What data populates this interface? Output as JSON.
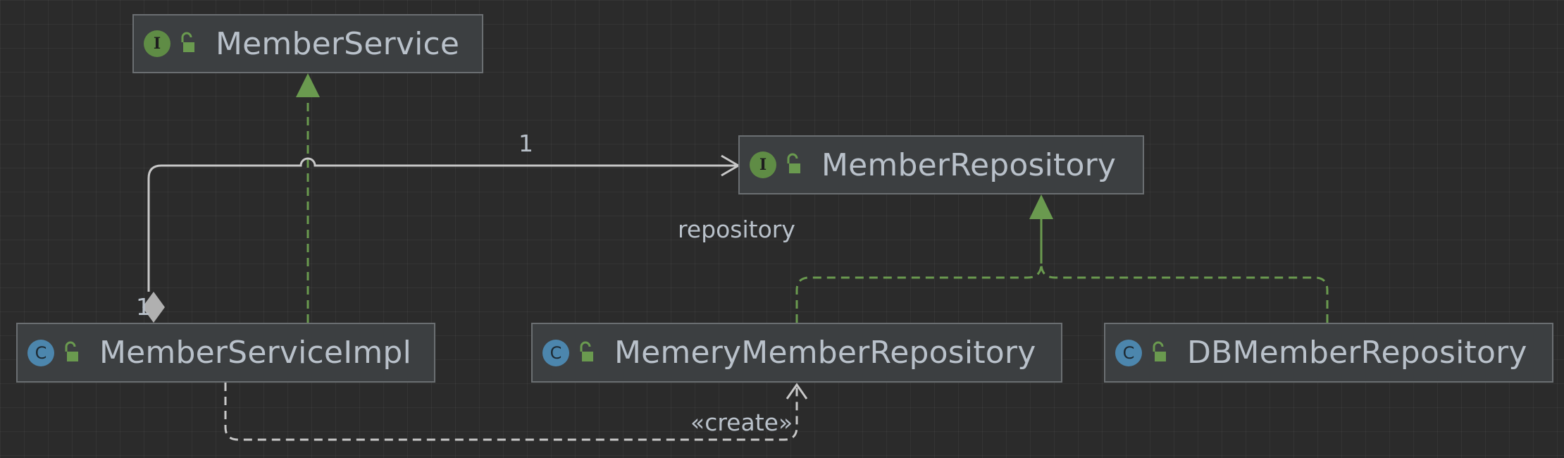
{
  "nodes": {
    "member_service": {
      "name": "MemberService",
      "kind": "I",
      "kind_icon": "interface-icon",
      "visibility_icon": "unlocked-icon"
    },
    "member_repository": {
      "name": "MemberRepository",
      "kind": "I",
      "kind_icon": "interface-icon",
      "visibility_icon": "unlocked-icon"
    },
    "member_service_impl": {
      "name": "MemberServiceImpl",
      "kind": "C",
      "kind_icon": "class-icon",
      "visibility_icon": "unlocked-icon"
    },
    "memery_member_repository": {
      "name": "MemeryMemberRepository",
      "kind": "C",
      "kind_icon": "class-icon",
      "visibility_icon": "unlocked-icon"
    },
    "db_member_repository": {
      "name": "DBMemberRepository",
      "kind": "C",
      "kind_icon": "class-icon",
      "visibility_icon": "unlocked-icon"
    }
  },
  "edges": {
    "aggregation": {
      "target_multiplicity": "1",
      "source_multiplicity": "1",
      "role": "repository"
    },
    "create_dependency": {
      "stereotype": "«create»"
    }
  },
  "colors": {
    "background": "#2b2b2b",
    "node_fill": "#3c3f41",
    "node_border": "#6b6f72",
    "text": "#b9c1ca",
    "interface_badge": "#5f8c45",
    "class_badge": "#4c86ad",
    "realization_edge": "#6a9a4f",
    "association_edge": "#c8c8c8"
  }
}
